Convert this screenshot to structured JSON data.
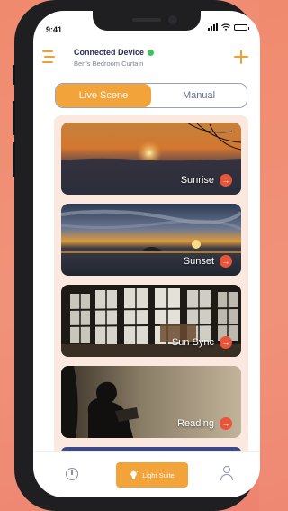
{
  "status_bar": {
    "time": "9:41"
  },
  "header": {
    "title": "Connected Device",
    "subtitle": "Ben's Bedroom Curtain",
    "connection_color": "#3cc45a",
    "menu_icon": "hamburger-menu-icon",
    "add_icon": "plus-icon"
  },
  "mode_toggle": {
    "options": [
      "Live Scene",
      "Manual"
    ],
    "selected": "Live Scene"
  },
  "scenes": [
    {
      "label": "Sunrise",
      "icon": "arrow-right-icon"
    },
    {
      "label": "Sunset",
      "icon": "arrow-right-icon"
    },
    {
      "label": "Sun Sync",
      "icon": "arrow-right-icon"
    },
    {
      "label": "Reading",
      "icon": "arrow-right-icon"
    }
  ],
  "tab_bar": {
    "items": [
      {
        "label": "",
        "icon": "timer-icon"
      },
      {
        "label": "Light Suite",
        "icon": "lightbulb-icon",
        "active": true
      },
      {
        "label": "",
        "icon": "profile-icon"
      }
    ]
  },
  "colors": {
    "accent": "#f2a33a",
    "scene_button": "#e8553a",
    "title_text": "#1f2a55",
    "list_background": "#fbe8df"
  }
}
